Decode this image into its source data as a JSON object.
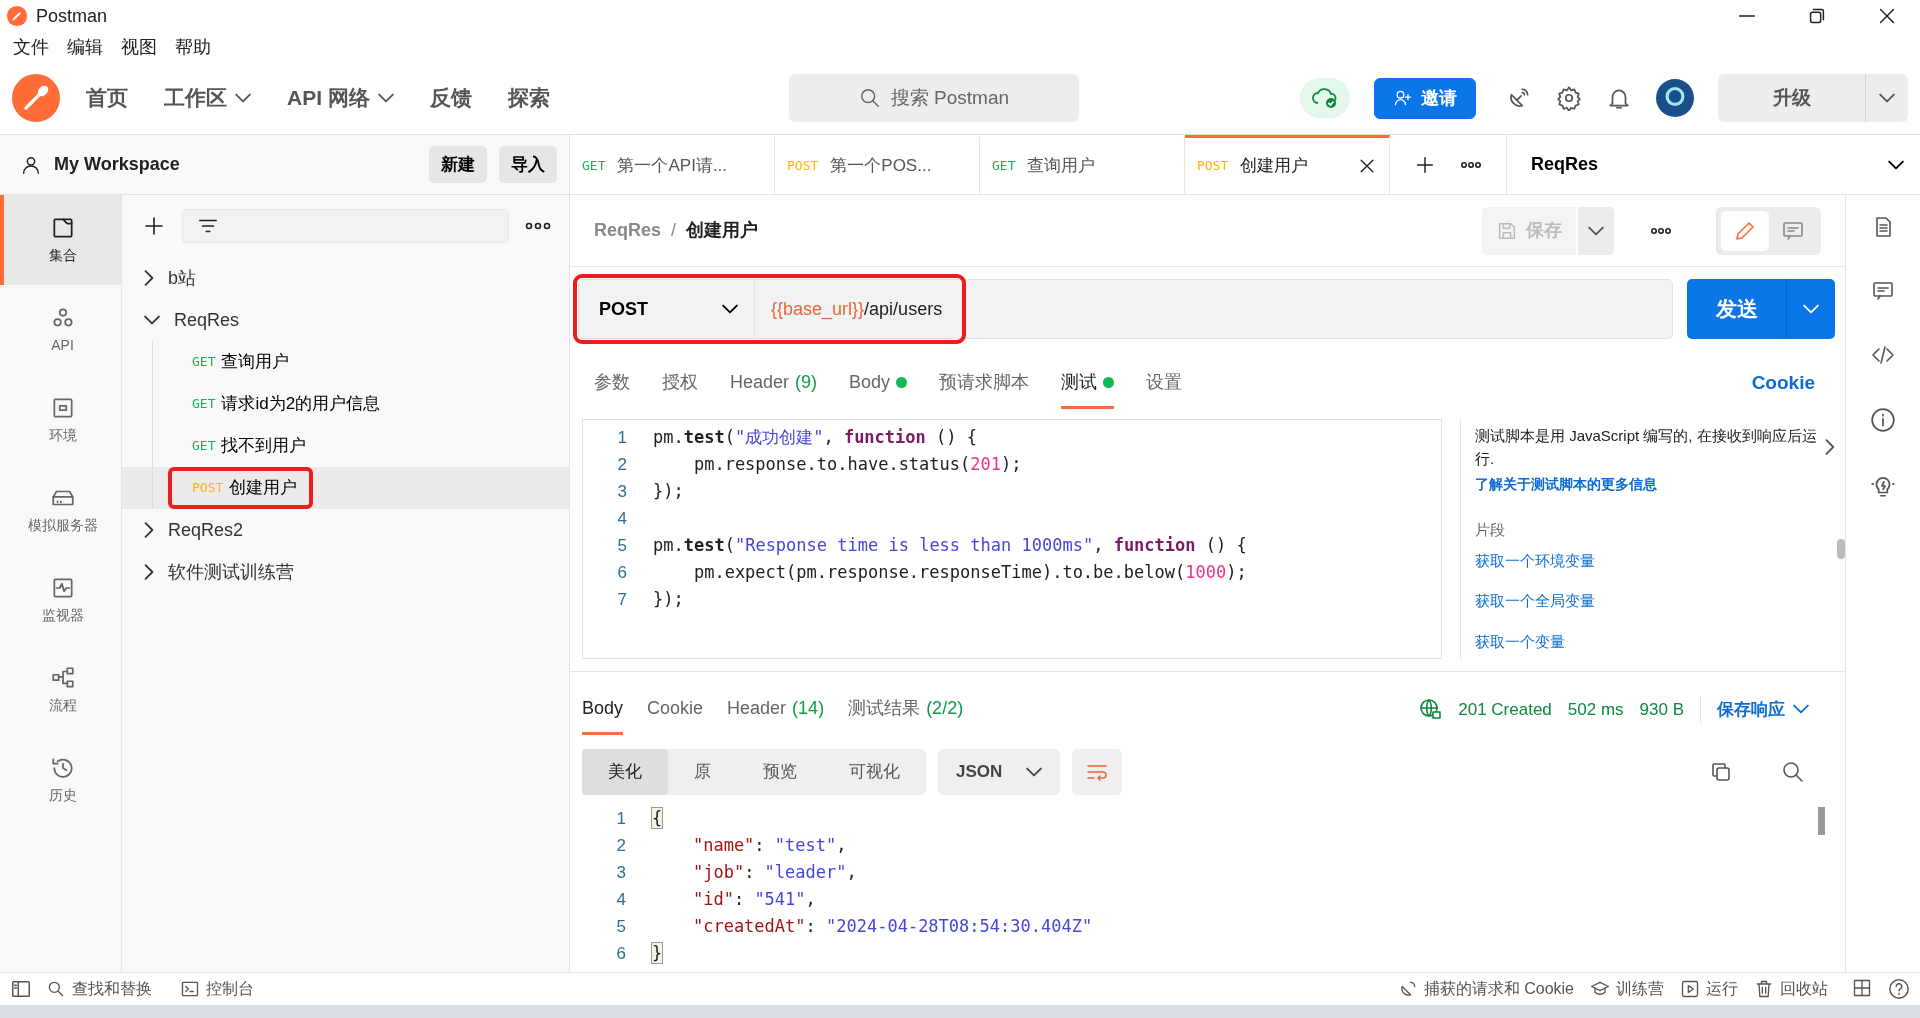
{
  "window": {
    "title": "Postman"
  },
  "menu": [
    "文件",
    "编辑",
    "视图",
    "帮助"
  ],
  "header": {
    "nav": [
      {
        "label": "首页",
        "dropdown": false
      },
      {
        "label": "工作区",
        "dropdown": true
      },
      {
        "label": "API 网络",
        "dropdown": true
      },
      {
        "label": "反馈",
        "dropdown": false
      },
      {
        "label": "探索",
        "dropdown": false
      }
    ],
    "search": {
      "placeholder": "搜索 Postman"
    },
    "invite": "邀请",
    "upgrade": "升级"
  },
  "workspace": {
    "name": "My Workspace",
    "buttons": [
      "新建",
      "导入"
    ]
  },
  "sidebar": {
    "items": [
      {
        "label": "集合",
        "selected": true
      },
      {
        "label": "API",
        "selected": false
      },
      {
        "label": "环境",
        "selected": false
      },
      {
        "label": "模拟服务器",
        "selected": false
      },
      {
        "label": "监视器",
        "selected": false
      },
      {
        "label": "流程",
        "selected": false
      },
      {
        "label": "历史",
        "selected": false
      }
    ]
  },
  "collections": [
    {
      "name": "b站",
      "expanded": false
    },
    {
      "name": "ReqRes",
      "expanded": true,
      "children": [
        {
          "method": "GET",
          "color": "#0cbb52",
          "name": "查询用户",
          "selected": false,
          "annotated": false
        },
        {
          "method": "GET",
          "color": "#0cbb52",
          "name": "请求id为2的用户信息",
          "selected": false,
          "annotated": false
        },
        {
          "method": "GET",
          "color": "#0cbb52",
          "name": "找不到用户",
          "selected": false,
          "annotated": false
        },
        {
          "method": "POST",
          "color": "#ffb400",
          "name": "创建用户",
          "selected": true,
          "annotated": true
        }
      ]
    },
    {
      "name": "ReqRes2",
      "expanded": false
    },
    {
      "name": "软件测试训练营",
      "expanded": false
    }
  ],
  "tabs": [
    {
      "method": "GET",
      "color": "#0cbb52",
      "label": "第一个API请...",
      "selected": false
    },
    {
      "method": "POST",
      "color": "#ffb400",
      "label": "第一个POS...",
      "selected": false
    },
    {
      "method": "GET",
      "color": "#0cbb52",
      "label": "查询用户",
      "selected": false
    },
    {
      "method": "POST",
      "color": "#ffb400",
      "label": "创建用户",
      "selected": true
    }
  ],
  "environment": {
    "name": "ReqRes"
  },
  "breadcrumb": {
    "parent": "ReqRes",
    "separator": "/",
    "current": "创建用户"
  },
  "save_button": {
    "label": "保存",
    "disabled": true
  },
  "modes": [
    {
      "selected": true
    },
    {
      "selected": false
    }
  ],
  "request": {
    "method": "POST",
    "url_variable": "{{base_url}}",
    "url_path": "/api/users",
    "annotated": true,
    "send": "发送"
  },
  "request_tabs": [
    {
      "label": "参数",
      "dot": false,
      "selected": false
    },
    {
      "label": "授权",
      "dot": false,
      "selected": false
    },
    {
      "label": "Header",
      "count": "(9)",
      "dot": false,
      "selected": false
    },
    {
      "label": "Body",
      "dot": true,
      "selected": false
    },
    {
      "label": "预请求脚本",
      "dot": false,
      "selected": false
    },
    {
      "label": "测试",
      "dot": true,
      "selected": true
    },
    {
      "label": "设置",
      "dot": false,
      "selected": false
    }
  ],
  "cookie_link": "Cookie",
  "script": {
    "lines": [
      {
        "number": "1",
        "tokens": [
          {
            "text": "pm.",
            "kind": "plain"
          },
          {
            "text": "test",
            "kind": "method"
          },
          {
            "text": "(",
            "kind": "plain"
          },
          {
            "text": "\"成功创建\"",
            "kind": "string"
          },
          {
            "text": ", ",
            "kind": "plain"
          },
          {
            "text": "function",
            "kind": "keyword"
          },
          {
            "text": " () {",
            "kind": "plain"
          }
        ]
      },
      {
        "number": "2",
        "tokens": [
          {
            "text": "    pm.response.to.have.status(",
            "kind": "plain"
          },
          {
            "text": "201",
            "kind": "number"
          },
          {
            "text": ");",
            "kind": "plain"
          }
        ]
      },
      {
        "number": "3",
        "tokens": [
          {
            "text": "});",
            "kind": "plain"
          }
        ]
      },
      {
        "number": "4"
      },
      {
        "number": "5",
        "tokens": [
          {
            "text": "pm.",
            "kind": "plain"
          },
          {
            "text": "test",
            "kind": "method"
          },
          {
            "text": "(",
            "kind": "plain"
          },
          {
            "text": "\"Response time is less than 1000ms\"",
            "kind": "string"
          },
          {
            "text": ", ",
            "kind": "plain"
          },
          {
            "text": "function",
            "kind": "keyword"
          },
          {
            "text": " () {",
            "kind": "plain"
          }
        ]
      },
      {
        "number": "6",
        "tokens": [
          {
            "text": "    pm.expect(pm.response.responseTime).to.be.below(",
            "kind": "plain"
          },
          {
            "text": "1000",
            "kind": "number"
          },
          {
            "text": ");",
            "kind": "plain"
          }
        ]
      },
      {
        "number": "7",
        "tokens": [
          {
            "text": "});",
            "kind": "plain"
          }
        ]
      }
    ]
  },
  "help": {
    "text": "测试脚本是用 JavaScript 编写的, 在接收到响应后运行.",
    "link": "了解关于测试脚本的更多信息",
    "snippets_title": "片段",
    "snippets": [
      "获取一个环境变量",
      "获取一个全局变量",
      "获取一个变量"
    ]
  },
  "response": {
    "tabs": [
      {
        "label": "Body",
        "selected": true
      },
      {
        "label": "Cookie",
        "selected": false
      },
      {
        "label": "Header",
        "count": "(14)",
        "selected": false
      },
      {
        "label": "测试结果",
        "count": "(2/2)",
        "selected": false
      }
    ],
    "status": "201 Created",
    "time": "502 ms",
    "size": "930 B",
    "save": "保存响应",
    "views": [
      {
        "label": "美化",
        "selected": true
      },
      {
        "label": "原",
        "selected": false
      },
      {
        "label": "预览",
        "selected": false
      },
      {
        "label": "可视化",
        "selected": false
      }
    ],
    "format": "JSON",
    "lines": [
      {
        "number": "1",
        "tokens": [
          {
            "text": "{",
            "kind": "brace"
          }
        ]
      },
      {
        "number": "2",
        "tokens": [
          {
            "text": "    \"name\"",
            "kind": "key"
          },
          {
            "text": ": ",
            "kind": "plain"
          },
          {
            "text": "\"test\"",
            "kind": "string"
          },
          {
            "text": ",",
            "kind": "plain"
          }
        ]
      },
      {
        "number": "3",
        "tokens": [
          {
            "text": "    \"job\"",
            "kind": "key"
          },
          {
            "text": ": ",
            "kind": "plain"
          },
          {
            "text": "\"leader\"",
            "kind": "string"
          },
          {
            "text": ",",
            "kind": "plain"
          }
        ]
      },
      {
        "number": "4",
        "tokens": [
          {
            "text": "    \"id\"",
            "kind": "key"
          },
          {
            "text": ": ",
            "kind": "plain"
          },
          {
            "text": "\"541\"",
            "kind": "string"
          },
          {
            "text": ",",
            "kind": "plain"
          }
        ]
      },
      {
        "number": "5",
        "tokens": [
          {
            "text": "    \"createdAt\"",
            "kind": "key"
          },
          {
            "text": ": ",
            "kind": "plain"
          },
          {
            "text": "\"2024-04-28T08:54:30.404Z\"",
            "kind": "string"
          }
        ]
      },
      {
        "number": "6",
        "tokens": [
          {
            "text": "}",
            "kind": "brace"
          }
        ]
      }
    ]
  },
  "status_bar": {
    "left": [
      "查找和替换",
      "控制台"
    ],
    "right": [
      "捕获的请求和 Cookie",
      "训练营",
      "运行",
      "回收站"
    ]
  }
}
